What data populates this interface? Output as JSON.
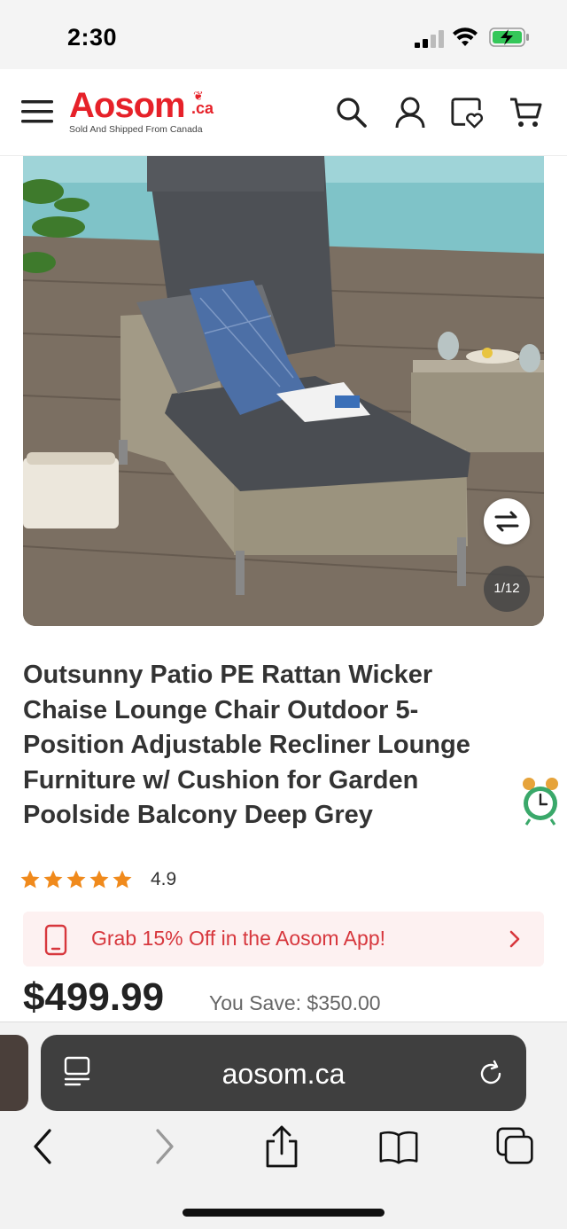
{
  "status_bar": {
    "time": "2:30"
  },
  "header": {
    "logo_main": "Aosom",
    "logo_suffix": ".ca",
    "logo_tagline": "Sold And Shipped From Canada",
    "icons": [
      "menu-icon",
      "search-icon",
      "account-icon",
      "wishlist-icon",
      "cart-icon"
    ]
  },
  "gallery": {
    "counter": "1/12"
  },
  "product": {
    "title": "Outsunny Patio PE Rattan Wicker Chaise Lounge Chair Outdoor 5-Position Adjustable Recliner Lounge Furniture w/ Cushion for Garden Poolside Balcony Deep Grey",
    "rating": "4.9",
    "stars": 5,
    "price": "$499.99",
    "you_save_label": "You Save: $350.00"
  },
  "promo": {
    "text": "Grab 15% Off in the Aosom App!"
  },
  "browser": {
    "url": "aosom.ca"
  },
  "colors": {
    "brand_red": "#e62129",
    "star_orange": "#f08a1c",
    "promo_bg": "#fdf1f1",
    "promo_text": "#d7373d"
  }
}
